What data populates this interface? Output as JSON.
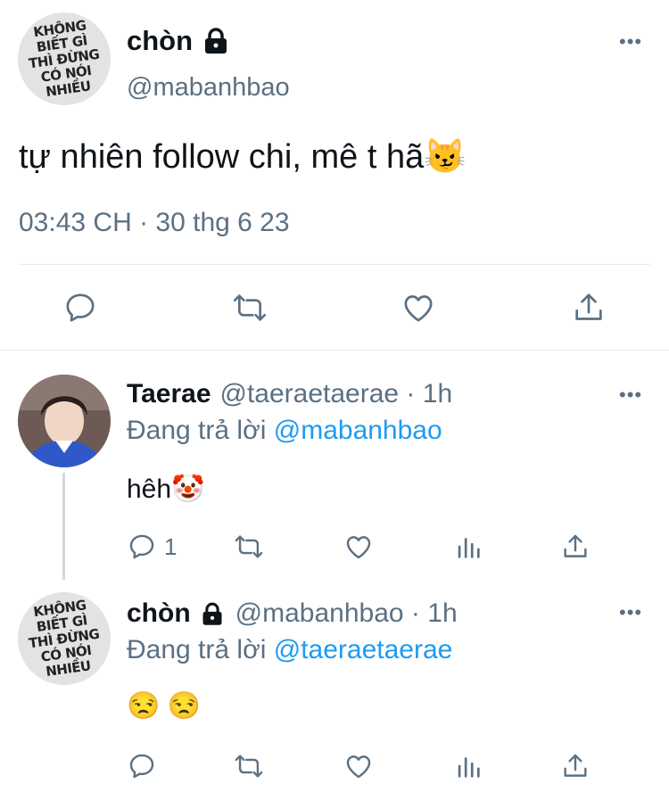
{
  "main_tweet": {
    "author_name": "chòn",
    "handle": "@mabanhbao",
    "text": "tự nhiên follow chi, mê t hã😼",
    "timestamp": "03:43 CH · 30 thg 6 23",
    "avatar_text": "KHÔNG\nBIẾT GÌ\nTHÌ ĐỪNG\nCÓ NÓI\nNHIỀU"
  },
  "replies": [
    {
      "author_name": "Taerae",
      "handle": "@taeraetaerae · 1h",
      "replying_prefix": "Đang trả lời ",
      "replying_to": "@mabanhbao",
      "text": "hêh🤡",
      "reply_count": "1"
    },
    {
      "author_name": "chòn",
      "handle": "@mabanhbao · 1h",
      "replying_prefix": "Đang trả lời ",
      "replying_to": "@taeraetaerae",
      "text": "😒 😒",
      "avatar_text": "KHÔNG\nBIẾT GÌ\nTHÌ ĐỪNG\nCÓ NÓI\nNHIỀU"
    }
  ],
  "colors": {
    "text": "#0f1419",
    "secondary": "#5b7083",
    "link": "#1d9bf0",
    "divider": "#e6ecf0"
  }
}
